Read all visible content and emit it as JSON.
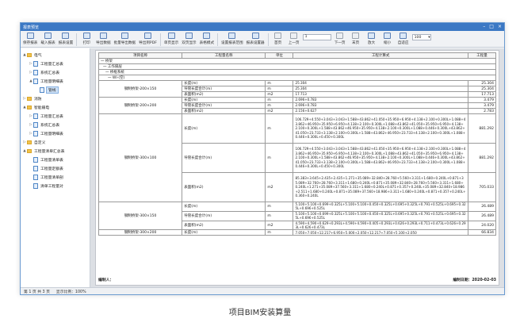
{
  "window": {
    "title": "报表预览",
    "controls": [
      "–",
      "□",
      "×"
    ]
  },
  "toolbar": {
    "buttons": [
      {
        "label": "保存报表",
        "icon": "save-icon"
      },
      {
        "label": "载入报表",
        "icon": "load-icon"
      },
      {
        "label": "报表设置",
        "icon": "report-settings-icon"
      },
      {
        "label": "打印",
        "icon": "print-icon"
      },
      {
        "label": "导出数据",
        "icon": "export-data-icon"
      },
      {
        "label": "批量导出数据",
        "icon": "batch-export-icon"
      },
      {
        "label": "导出到PDF",
        "icon": "export-pdf-icon"
      },
      {
        "label": "单页显示",
        "icon": "single-page-icon"
      },
      {
        "label": "双页显示",
        "icon": "double-page-icon"
      },
      {
        "label": "表格模式",
        "icon": "table-mode-icon"
      },
      {
        "label": "设置报表范围",
        "icon": "report-range-icon"
      },
      {
        "label": "报表设置器",
        "icon": "report-designer-icon"
      }
    ],
    "nav": [
      {
        "label": "首页",
        "icon": "first-page-icon"
      },
      {
        "label": "上一页",
        "icon": "prev-page-icon"
      }
    ],
    "page_value": "1",
    "nav2": [
      {
        "label": "下一页",
        "icon": "next-page-icon"
      },
      {
        "label": "末页",
        "icon": "last-page-icon"
      },
      {
        "label": "放大",
        "icon": "zoom-in-icon"
      },
      {
        "label": "缩小",
        "icon": "zoom-out-icon"
      },
      {
        "label": "自适应",
        "icon": "fit-icon"
      }
    ],
    "zoom_value": "100"
  },
  "tree": [
    {
      "level": 0,
      "toggle": "▲",
      "type": "folder",
      "label": "电气"
    },
    {
      "level": 1,
      "toggle": "▷",
      "type": "doc",
      "label": "工程量汇总表"
    },
    {
      "level": 1,
      "toggle": "▷",
      "type": "doc",
      "label": "系统汇总表"
    },
    {
      "level": 1,
      "toggle": "▲",
      "type": "doc",
      "label": "工程量明细表"
    },
    {
      "level": 2,
      "toggle": "",
      "type": "doc",
      "label": "管线",
      "selected": true
    },
    {
      "level": 0,
      "toggle": "▷",
      "type": "folder",
      "label": "消防"
    },
    {
      "level": 0,
      "toggle": "▲",
      "type": "folder",
      "label": "智能弱电"
    },
    {
      "level": 1,
      "toggle": "▷",
      "type": "doc",
      "label": "工程量汇总表"
    },
    {
      "level": 1,
      "toggle": "▷",
      "type": "doc",
      "label": "系统汇总表"
    },
    {
      "level": 1,
      "toggle": "▷",
      "type": "doc",
      "label": "工程量明细表"
    },
    {
      "level": 0,
      "toggle": "▷",
      "type": "folder",
      "label": "自定义"
    },
    {
      "level": 0,
      "toggle": "▲",
      "type": "folder",
      "label": "工程量清单汇总表"
    },
    {
      "level": 1,
      "toggle": "",
      "type": "doc",
      "label": "工程量清单表"
    },
    {
      "level": 1,
      "toggle": "",
      "type": "doc",
      "label": "工程量定额表"
    },
    {
      "level": 1,
      "toggle": "",
      "type": "doc",
      "label": "工程量清单剖"
    },
    {
      "level": 1,
      "toggle": "",
      "type": "doc",
      "label": "清单工程量对"
    }
  ],
  "report": {
    "headers": [
      "项目名称",
      "工程量名称",
      "单位",
      "工程计算式",
      "工程量"
    ],
    "group_rows": [
      "一 桥架",
      "一 工作隔层",
      "一 桥框系统",
      "一 WI-(空)"
    ],
    "rows": [
      {
        "item": "钢制桥架-200×150",
        "span": 3,
        "lines": [
          {
            "name": "长度(m)",
            "unit": "m",
            "expr": "25.304",
            "qty": "25.304"
          },
          {
            "name": "导管长度合计(m)",
            "unit": "m",
            "expr": "25.304",
            "qty": "25.304"
          },
          {
            "name": "表面积(m2)",
            "unit": "m2",
            "expr": "17.713",
            "qty": "17.713"
          }
        ]
      },
      {
        "item": "钢制桥架-200×200",
        "span": 3,
        "lines": [
          {
            "name": "长度(m)",
            "unit": "m",
            "expr": "2.696+0.783",
            "qty": "3.479"
          },
          {
            "name": "导管长度合计(m)",
            "unit": "m",
            "expr": "2.696+0.783",
            "qty": "3.479"
          },
          {
            "name": "表面积(m2)",
            "unit": "m2",
            "expr": "2.156+0.627",
            "qty": "2.783"
          }
        ]
      },
      {
        "item": "钢制桥架-300×100",
        "span": 3,
        "lines": [
          {
            "name": "长度(m)",
            "unit": "m",
            "expr": "106.729+4.550+3.043+3.043+1.588+43.862+41.050+35.950+6.950+4.138+2.100+0.300L+1.088+43.862+46.950+35.950+6.950+4.138+2.100+0.300L+1.088+43.862+41.050+35.950+6.950+4.138+2.100+0.300L+1.588+43.862+46.950+35.950+4.138+2.100+0.300L+1.088+0.446+0.300L+43.862+41.050+23.733+3.138+2.100+0.300L+1.588+43.862+46.950+23.733+4.138+2.100+0.300L+1.088+0.446+0.300L+0.450+0.300L",
            "qty": "881.292",
            "tall": true
          },
          {
            "name": "导管长度合计(m)",
            "unit": "m",
            "expr": "106.729+4.550+3.043+3.043+1.588+43.862+41.050+35.950+6.950+4.138+2.100+0.300L+1.088+43.862+46.950+35.950+6.950+4.138+2.100+0.300L+1.088+43.862+41.050+35.950+6.950+4.138+2.100+0.300L+1.588+43.862+46.950+35.950+4.138+2.100+0.300L+1.088+0.446+0.300L+43.862+41.050+23.733+3.138+2.100+0.300L+1.588+43.862+46.950+23.733+4.138+2.100+0.300L+1.088+0.446+0.300L+0.450+0.300L",
            "qty": "881.292",
            "tall": true
          },
          {
            "name": "表面积(m2)",
            "unit": "m2",
            "expr": "85.383+3.645+2.435+2.435+1.271+35.089+32.840+28.760+5.560+3.311+1.680+0.240L+0.871+35.089+32.760+28.760+3.311+1.680+0.240L+0.871+35.089+32.840+28.760+5.560+3.311+1.680+0.240L+1.271+35.089+37.560+3.311+1.680+0.240L+0.871+0.357+0.240L+35.089+32.840+18.986+2.511+1.680+0.240L+0.871+35.089+37.560+18.986+3.311+1.680+0.240L+0.871+0.357+0.240L+0.360+0.240L",
            "qty": "705.033",
            "tall": true
          }
        ]
      },
      {
        "item": "钢制桥架-300×150",
        "span": 3,
        "lines": [
          {
            "name": "长度(m)",
            "unit": "m",
            "expr": "5.100+5.100+0.699+0.325L+5.100+5.100+0.450+0.325L+0.695+0.325L+0.791+0.525L+0.695+0.325L+0.696+0.525L",
            "qty": "26.489",
            "mid": true
          },
          {
            "name": "导管长度合计(m)",
            "unit": "m",
            "expr": "5.100+5.100+0.699+0.325L+5.100+5.100+0.450+0.325L+0.695+0.325L+0.791+0.525L+0.695+0.325L+0.696+0.525L",
            "qty": "26.489",
            "mid": true
          },
          {
            "name": "表面积(m2)",
            "unit": "m2",
            "expr": "4.590+4.590+0.629+0.293L+4.590+4.590+0.405+0.293L+0.626+0.293L+0.711+0.473L+0.626+0.293L+0.626+0.473L",
            "qty": "24.020",
            "mid": true
          }
        ]
      },
      {
        "item": "钢制桥架-300×200",
        "span": 1,
        "lines": [
          {
            "name": "长度(m)",
            "unit": "m",
            "expr": "7.050+7.050+12.217+6.950+5.000+2.050+12.217+7.050+5.100+2.050",
            "qty": "66.834"
          }
        ]
      }
    ],
    "footer_left": "编制人：",
    "footer_right": "编制日期：2020-02-03"
  },
  "status": {
    "page_info": "第 1 页  共 3 页",
    "zoom_info": "显示比例：100%"
  },
  "caption": "项目BIM安装算量"
}
